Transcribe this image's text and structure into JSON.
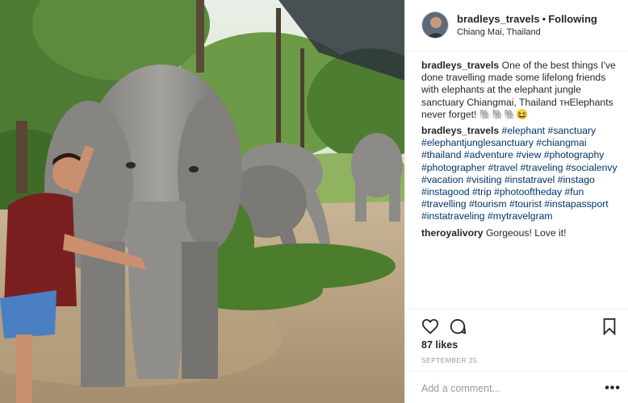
{
  "photo": {
    "description_icon": "elephant-photo"
  },
  "post": {
    "username": "bradleys_travels",
    "separator": "•",
    "follow_label": "Following",
    "location": "Chiang Mai, Thailand"
  },
  "comments": [
    {
      "user": "bradleys_travels",
      "text": "One of the best things I've done travelling made some lifelong friends with elephants at the elephant jungle sanctuary Chiangmai, Thailand ᴛʜElephants never forget! 🐘🐘🐘😆"
    },
    {
      "user": "bradleys_travels",
      "tags": "#elephant #sanctuary #elephantjunglesanctuary #chiangmai #thailand #adventure #view #photography #photographer #travel #traveling #socialenvy #vacation #visiting #instatravel #instago #instagood #trip #photooftheday #fun #travelling #tourism #tourist #instapassport #instatraveling #mytravelgram"
    },
    {
      "user": "theroyalivory",
      "text": "Gorgeous! Love it!"
    }
  ],
  "actions": {
    "like_icon": "heart-icon",
    "comment_icon": "comment-bubble-icon",
    "save_icon": "bookmark-icon"
  },
  "likes": "87 likes",
  "date": "SEPTEMBER 25",
  "add_comment": {
    "placeholder": "Add a comment...",
    "more_label": "•••"
  }
}
